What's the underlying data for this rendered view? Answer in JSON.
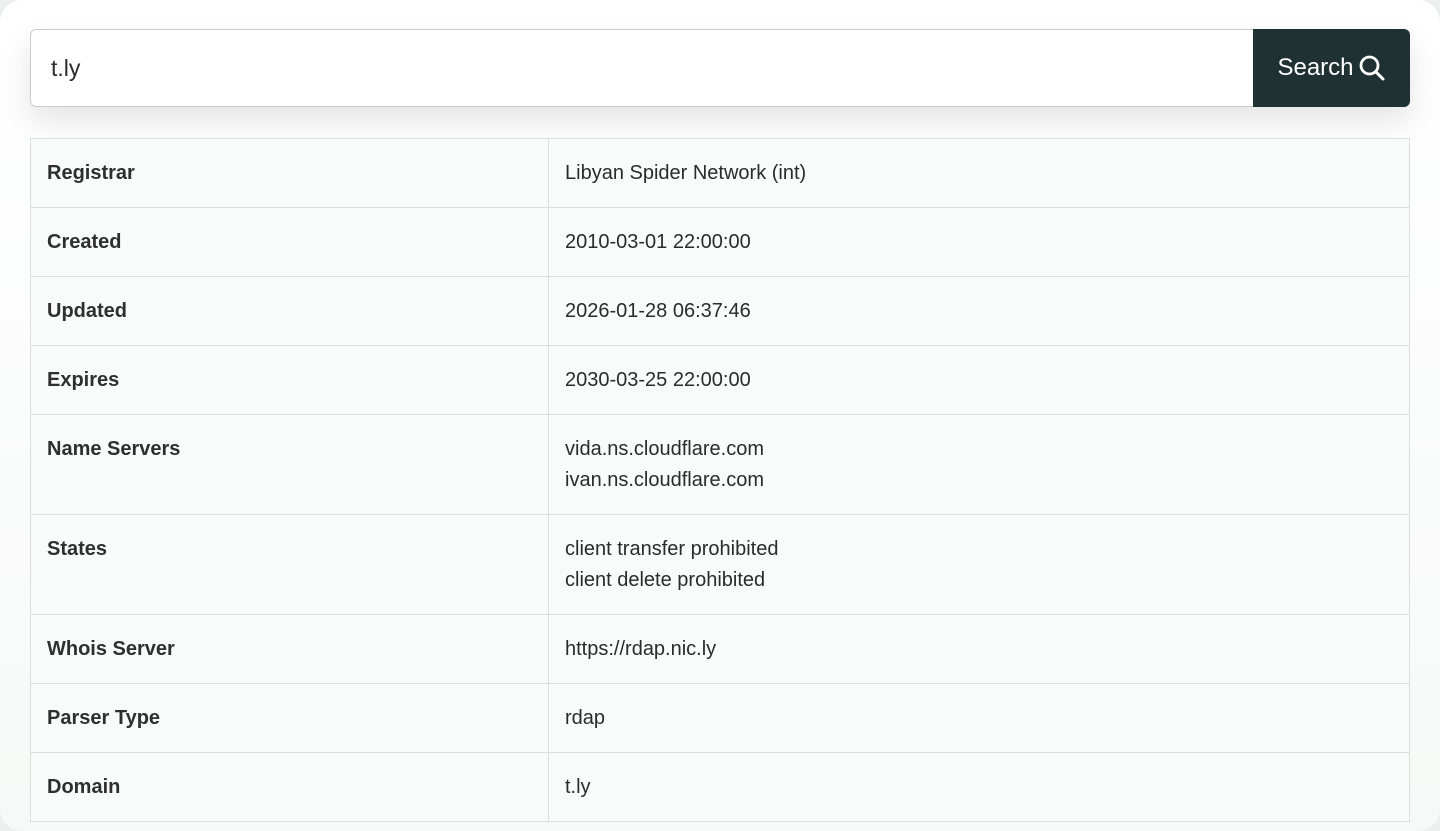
{
  "search": {
    "query": "t.ly",
    "button_label": "Search",
    "button_icon": "search-icon"
  },
  "colors": {
    "button_bg": "#1f3132",
    "table_border": "#dcdfde"
  },
  "whois": {
    "rows": [
      {
        "key": "Registrar",
        "values": [
          "Libyan Spider Network (int)"
        ]
      },
      {
        "key": "Created",
        "values": [
          "2010-03-01 22:00:00"
        ]
      },
      {
        "key": "Updated",
        "values": [
          "2026-01-28 06:37:46"
        ]
      },
      {
        "key": "Expires",
        "values": [
          "2030-03-25 22:00:00"
        ]
      },
      {
        "key": "Name Servers",
        "values": [
          "vida.ns.cloudflare.com",
          "ivan.ns.cloudflare.com"
        ]
      },
      {
        "key": "States",
        "values": [
          "client transfer prohibited",
          "client delete prohibited"
        ]
      },
      {
        "key": "Whois Server",
        "values": [
          "https://rdap.nic.ly"
        ]
      },
      {
        "key": "Parser Type",
        "values": [
          "rdap"
        ]
      },
      {
        "key": "Domain",
        "values": [
          "t.ly"
        ]
      }
    ]
  }
}
